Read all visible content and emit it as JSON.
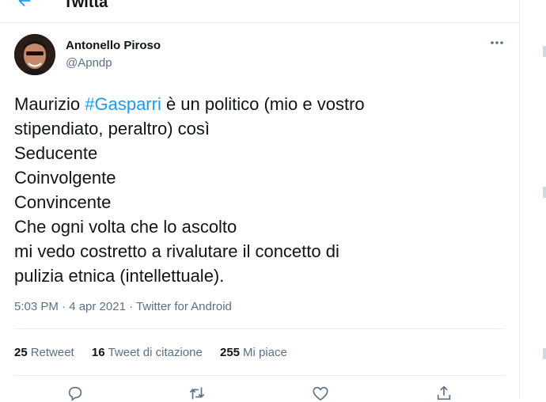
{
  "header": {
    "title": "Twitta"
  },
  "author": {
    "name": "Antonello Piroso",
    "handle": "@Apndp"
  },
  "tweet": {
    "line1_pre": "Maurizio ",
    "line1_hashtag": "#Gasparri",
    "line1_post": " è un politico (mio e vostro",
    "line2": "stipendiato, peraltro) così",
    "line3": "Seducente",
    "line4": "Coinvolgente",
    "line5": "Convincente",
    "line6": "Che ogni volta che lo ascolto",
    "line7": "mi vedo costretto a rivalutare il concetto di",
    "line8": "pulizia etnica (intellettuale)."
  },
  "meta": {
    "time": "5:03 PM · 4 apr 2021 · ",
    "source": "Twitter for Android"
  },
  "stats": {
    "retweets_count": "25",
    "retweets_label": "Retweet",
    "quotes_count": "16",
    "quotes_label": "Tweet di citazione",
    "likes_count": "255",
    "likes_label": "Mi piace"
  },
  "colors": {
    "accent": "#1d9bf0",
    "muted": "#5b7083",
    "text": "#0f1419",
    "border": "#e6ecf0"
  },
  "icons": [
    "back-arrow-icon",
    "more-icon",
    "reply-icon",
    "retweet-icon",
    "like-icon",
    "share-icon"
  ]
}
